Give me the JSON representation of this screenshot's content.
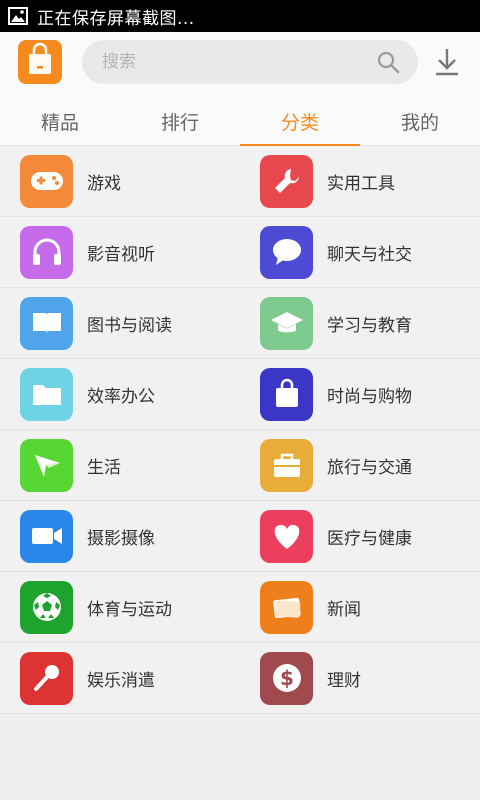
{
  "status_bar": {
    "text": "正在保存屏幕截图..."
  },
  "search": {
    "placeholder": "搜索"
  },
  "tabs": [
    {
      "label": "精品"
    },
    {
      "label": "排行"
    },
    {
      "label": "分类"
    },
    {
      "label": "我的"
    }
  ],
  "active_tab": "分类",
  "colors": {
    "accent": "#f58a1f",
    "game": "#f5893a",
    "tools": "#e6484d",
    "music": "#c56ae8",
    "chat": "#4d4ad4",
    "books": "#4fa4ea",
    "education": "#7ec98d",
    "office": "#6ed3e4",
    "fashion": "#3a37c6",
    "life": "#58d633",
    "travel": "#e8ad38",
    "photo": "#2b86e9",
    "health": "#ec3f5d",
    "sports": "#1ea32c",
    "news": "#ef7f1a",
    "music_mic": "#dd3333",
    "finance": "#a0494f"
  },
  "categories": [
    {
      "label": "游戏",
      "icon": "gamepad-icon"
    },
    {
      "label": "实用工具",
      "icon": "wrench-icon"
    },
    {
      "label": "影音视听",
      "icon": "headphones-icon"
    },
    {
      "label": "聊天与社交",
      "icon": "chat-bubble-icon"
    },
    {
      "label": "图书与阅读",
      "icon": "open-book-icon"
    },
    {
      "label": "学习与教育",
      "icon": "graduation-cap-icon"
    },
    {
      "label": "效率办公",
      "icon": "folder-icon"
    },
    {
      "label": "时尚与购物",
      "icon": "shopping-bag-icon"
    },
    {
      "label": "生活",
      "icon": "paper-plane-icon"
    },
    {
      "label": "旅行与交通",
      "icon": "suitcase-icon"
    },
    {
      "label": "摄影摄像",
      "icon": "video-camera-icon"
    },
    {
      "label": "医疗与健康",
      "icon": "heart-icon"
    },
    {
      "label": "体育与运动",
      "icon": "soccer-ball-icon"
    },
    {
      "label": "新闻",
      "icon": "newspaper-icon"
    },
    {
      "label": "娱乐消遣",
      "icon": "microphone-icon"
    },
    {
      "label": "理财",
      "icon": "dollar-icon"
    }
  ]
}
